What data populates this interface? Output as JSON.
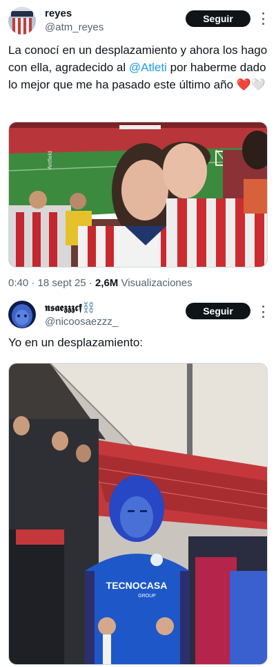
{
  "tweets": [
    {
      "display_name": "reyes",
      "handle": "@atm_reyes",
      "follow_label": "Seguir",
      "text_before": "La conocí en un desplazamiento y ahora los hago con ella, agradecido al ",
      "mention": "@Atleti",
      "text_after": " por haberme dado lo mejor que me ha pasado este último año ❤️🤍",
      "time": "0:40",
      "date": "18 sept 25",
      "views_count": "2,6M",
      "views_label": "Visualizaciones",
      "media_caption": "Antfield"
    },
    {
      "display_name": "𝖓𝖘𝖆𝖊𝖟𝖟𝖟𝖈𝖋⛓️",
      "handle": "@nicoosaezzz_",
      "follow_label": "Seguir",
      "text": "Yo en un desplazamiento:",
      "media_shirt_text": "TECNOCASA",
      "media_shirt_subtext": "GROUP"
    }
  ],
  "colors": {
    "accent": "#1d9bf0",
    "atleti_red": "#cb3524",
    "getafe_blue": "#1e58c8",
    "text_secondary": "#536471"
  }
}
